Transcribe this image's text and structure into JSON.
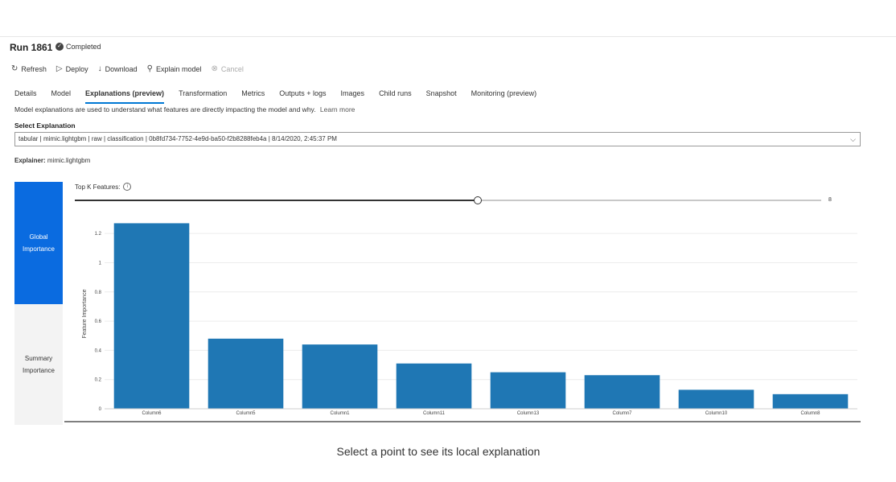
{
  "header": {
    "run_title": "Run 1861",
    "status": "Completed",
    "status_icon": "check-circle-icon"
  },
  "toolbar": {
    "refresh": "Refresh",
    "deploy": "Deploy",
    "download": "Download",
    "explain": "Explain model",
    "cancel": "Cancel"
  },
  "tabs": [
    {
      "label": "Details"
    },
    {
      "label": "Model"
    },
    {
      "label": "Explanations (preview)",
      "active": true
    },
    {
      "label": "Transformation"
    },
    {
      "label": "Metrics"
    },
    {
      "label": "Outputs + logs"
    },
    {
      "label": "Images"
    },
    {
      "label": "Child runs"
    },
    {
      "label": "Snapshot"
    },
    {
      "label": "Monitoring (preview)"
    }
  ],
  "intro": {
    "text": "Model explanations are used to understand what features are directly impacting the model and why.",
    "link": "Learn more"
  },
  "select_explanation": {
    "label": "Select Explanation",
    "value": "tabular | mimic.lightgbm | raw | classification | 0b8fd734-7752-4e9d-ba50-f2b8288feb4a | 8/14/2020, 2:45:37 PM"
  },
  "explainer": {
    "label": "Explainer:",
    "value": "mimic.lightgbm"
  },
  "side_tabs": {
    "global_line1": "Global",
    "global_line2": "Importance",
    "summary_line1": "Summary",
    "summary_line2": "Importance"
  },
  "topk": {
    "label": "Top K Features:",
    "value": "8",
    "fraction": 0.54
  },
  "footer": {
    "message": "Select a point to see its local explanation"
  },
  "colors": {
    "bar": "#1f77b4",
    "accent": "#0a6be0"
  },
  "chart_data": {
    "type": "bar",
    "categories": [
      "Column6",
      "Column5",
      "Column1",
      "Column11",
      "Column13",
      "Column7",
      "Column10",
      "Column8"
    ],
    "values": [
      1.27,
      0.48,
      0.44,
      0.31,
      0.25,
      0.23,
      0.13,
      0.1
    ],
    "title": "",
    "xlabel": "",
    "ylabel": "Feature Importance",
    "ylim": [
      0,
      1.3
    ],
    "yticks": [
      0,
      0.2,
      0.4,
      0.6,
      0.8,
      1,
      1.2
    ],
    "ytick_labels": [
      "0",
      "0.2",
      "0.4",
      "0.6",
      "0.8",
      "1",
      "1.2"
    ],
    "grid": true
  }
}
